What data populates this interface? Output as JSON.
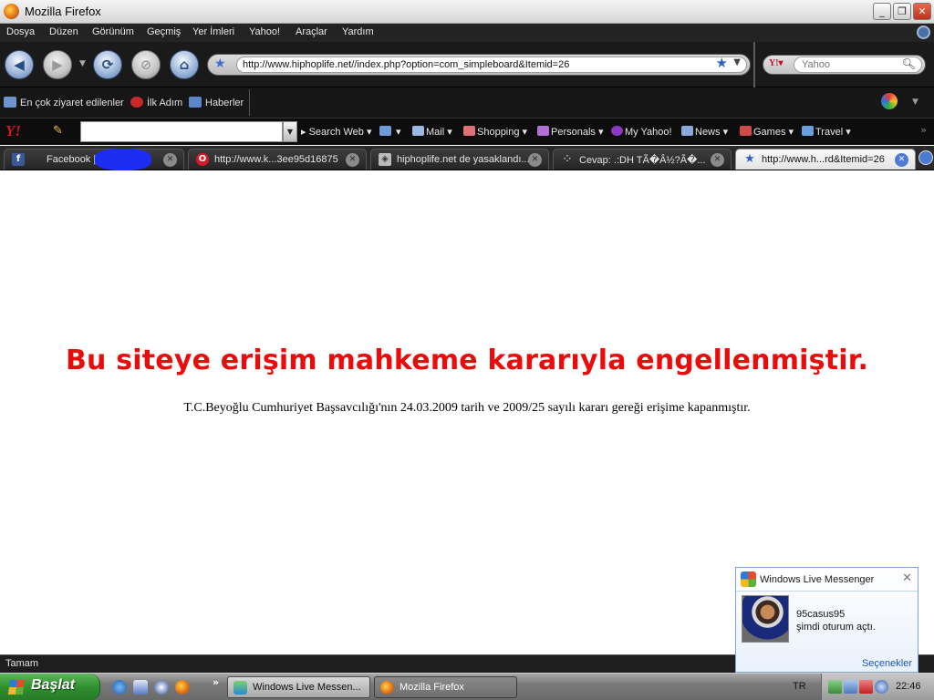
{
  "window": {
    "title": "Mozilla Firefox"
  },
  "menu": {
    "items": [
      "Dosya",
      "Düzen",
      "Görünüm",
      "Geçmiş",
      "Yer İmleri",
      "Yahoo!",
      "Araçlar",
      "Yardım"
    ]
  },
  "navbar": {
    "url": "http://www.hiphoplife.net//index.php?option=com_simpleboard&Itemid=26",
    "search_placeholder": "Yahoo"
  },
  "bookmarks": {
    "items": [
      "En çok ziyaret edilenler",
      "İlk Adım",
      "Haberler"
    ]
  },
  "yahoo_toolbar": {
    "search_web": "Search Web",
    "items": [
      "Mail",
      "Shopping",
      "Personals",
      "My Yahoo!",
      "News",
      "Games",
      "Travel"
    ]
  },
  "tabs": [
    {
      "label": "Facebook |",
      "icon": "facebook-icon",
      "active": false
    },
    {
      "label": "http://www.k...3ee95d16875",
      "icon": "opera-icon",
      "active": false
    },
    {
      "label": "hiphoplife.net de yasaklandı...",
      "icon": "page-icon",
      "active": false
    },
    {
      "label": "Cevap: .:DH TÃ�Â½?Ã�...",
      "icon": "loading-icon",
      "active": false
    },
    {
      "label": "http://www.h...rd&Itemid=26",
      "icon": "star-icon",
      "active": true
    }
  ],
  "content": {
    "headline": "Bu siteye erişim mahkeme kararıyla engellenmiştir.",
    "subline": "T.C.Beyoğlu Cumhuriyet Başsavcılığı'nın 24.03.2009 tarih ve 2009/25 sayılı kararı gereği erişime kapanmıştır."
  },
  "status": {
    "text": "Tamam"
  },
  "messenger_toast": {
    "title": "Windows Live Messenger",
    "user": "95casus95",
    "message": "şimdi oturum açtı.",
    "options": "Seçenekler"
  },
  "taskbar": {
    "start_label": "Başlat",
    "tasks": [
      "Windows Live Messen...",
      "Mozilla Firefox"
    ],
    "language": "TR",
    "clock": "22:46"
  },
  "colors": {
    "headline": "#ea0b0b",
    "menu_bg": "#232323",
    "active_tab_close": "#4b7bd0"
  }
}
